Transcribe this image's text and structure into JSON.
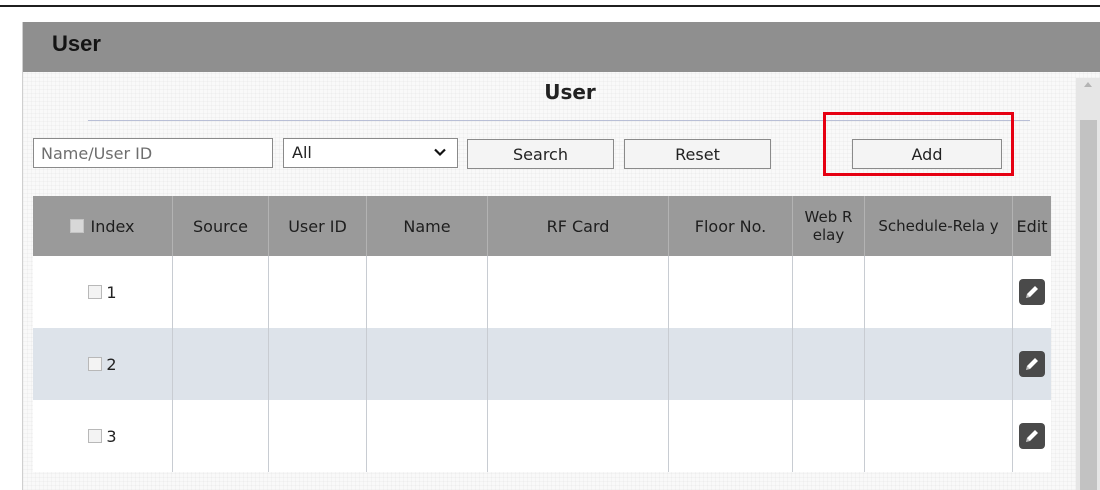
{
  "page": {
    "header_title": "User",
    "section_title": "User"
  },
  "toolbar": {
    "search_placeholder": "Name/User ID",
    "source_filter": {
      "selected": "All",
      "icon": "chevron-down-icon"
    },
    "search_label": "Search",
    "reset_label": "Reset",
    "add_label": "Add",
    "highlight_color": "#e60012"
  },
  "table": {
    "columns": [
      "Index",
      "Source",
      "User ID",
      "Name",
      "RF Card",
      "Floor No.",
      "Web R elay",
      "Schedule-Rela y",
      "Edit"
    ],
    "rows": [
      {
        "index": "1",
        "source": "",
        "user_id": "",
        "name": "",
        "rf_card": "",
        "floor_no": "",
        "web_relay": "",
        "schedule_relay": "",
        "edit_icon": "edit-pencil-icon"
      },
      {
        "index": "2",
        "source": "",
        "user_id": "",
        "name": "",
        "rf_card": "",
        "floor_no": "",
        "web_relay": "",
        "schedule_relay": "",
        "edit_icon": "edit-pencil-icon"
      },
      {
        "index": "3",
        "source": "",
        "user_id": "",
        "name": "",
        "rf_card": "",
        "floor_no": "",
        "web_relay": "",
        "schedule_relay": "",
        "edit_icon": "edit-pencil-icon"
      }
    ]
  },
  "colors": {
    "header_bar": "#8f8f8f",
    "table_header": "#9a9a9a",
    "row_alt": "#dde3ea"
  }
}
